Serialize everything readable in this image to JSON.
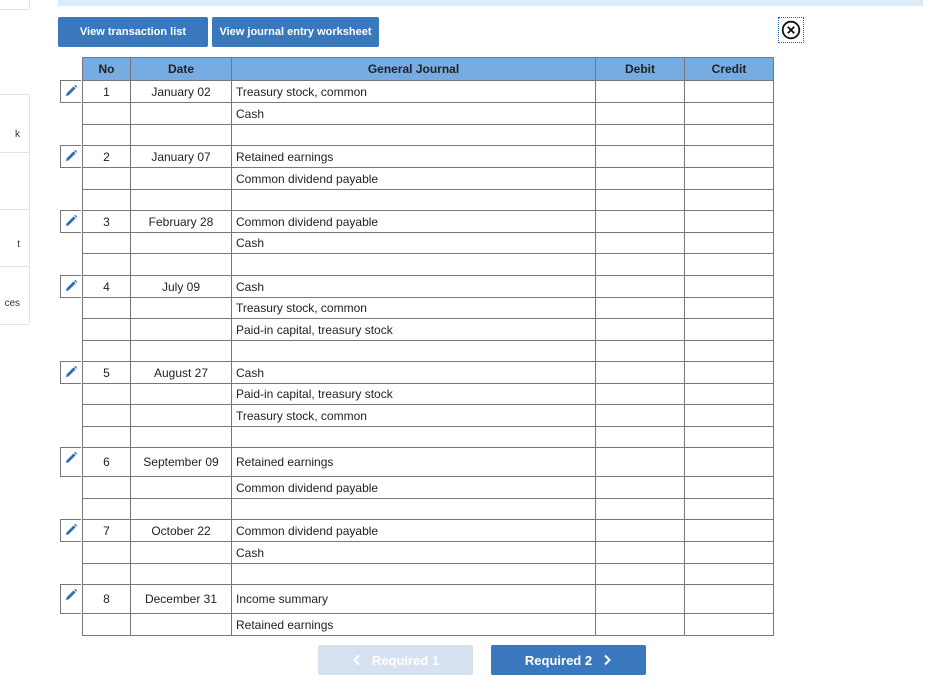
{
  "toolbar": {
    "view_transactions_label": "View transaction list",
    "view_worksheet_label": "View journal entry worksheet"
  },
  "side_panel": {
    "fragments": [
      "k",
      "",
      "t",
      "ces"
    ]
  },
  "table": {
    "headers": {
      "no": "No",
      "date": "Date",
      "general": "General Journal",
      "debit": "Debit",
      "credit": "Credit"
    },
    "entries": [
      {
        "no": "1",
        "date": "January 02",
        "lines": [
          "Treasury stock, common",
          "Cash",
          ""
        ]
      },
      {
        "no": "2",
        "date": "January 07",
        "lines": [
          "Retained earnings",
          "Common dividend payable",
          ""
        ]
      },
      {
        "no": "3",
        "date": "February 28",
        "lines": [
          "Common dividend payable",
          "Cash",
          ""
        ]
      },
      {
        "no": "4",
        "date": "July 09",
        "lines": [
          "Cash",
          "Treasury stock, common",
          "Paid-in capital, treasury stock",
          ""
        ]
      },
      {
        "no": "5",
        "date": "August 27",
        "lines": [
          "Cash",
          "Paid-in capital, treasury stock",
          "Treasury stock, common",
          ""
        ]
      },
      {
        "no": "6",
        "date": "September 09",
        "lines": [
          "Retained earnings",
          "Common dividend payable",
          ""
        ]
      },
      {
        "no": "7",
        "date": "October 22",
        "lines": [
          "Common dividend payable",
          "Cash",
          ""
        ]
      },
      {
        "no": "8",
        "date": "December 31",
        "lines": [
          "Income summary",
          "Retained earnings"
        ]
      }
    ]
  },
  "nav": {
    "prev_label": "Required 1",
    "next_label": "Required 2",
    "prev_enabled": false
  },
  "icons": {
    "edit": "pencil-icon",
    "close": "close-circle-icon",
    "prev": "chevron-left-icon",
    "next": "chevron-right-icon"
  },
  "colors": {
    "primary": "#3a78bd",
    "header_bg": "#77ace3",
    "disabled": "#d6e2f0",
    "pencil": "#2f6db5"
  }
}
